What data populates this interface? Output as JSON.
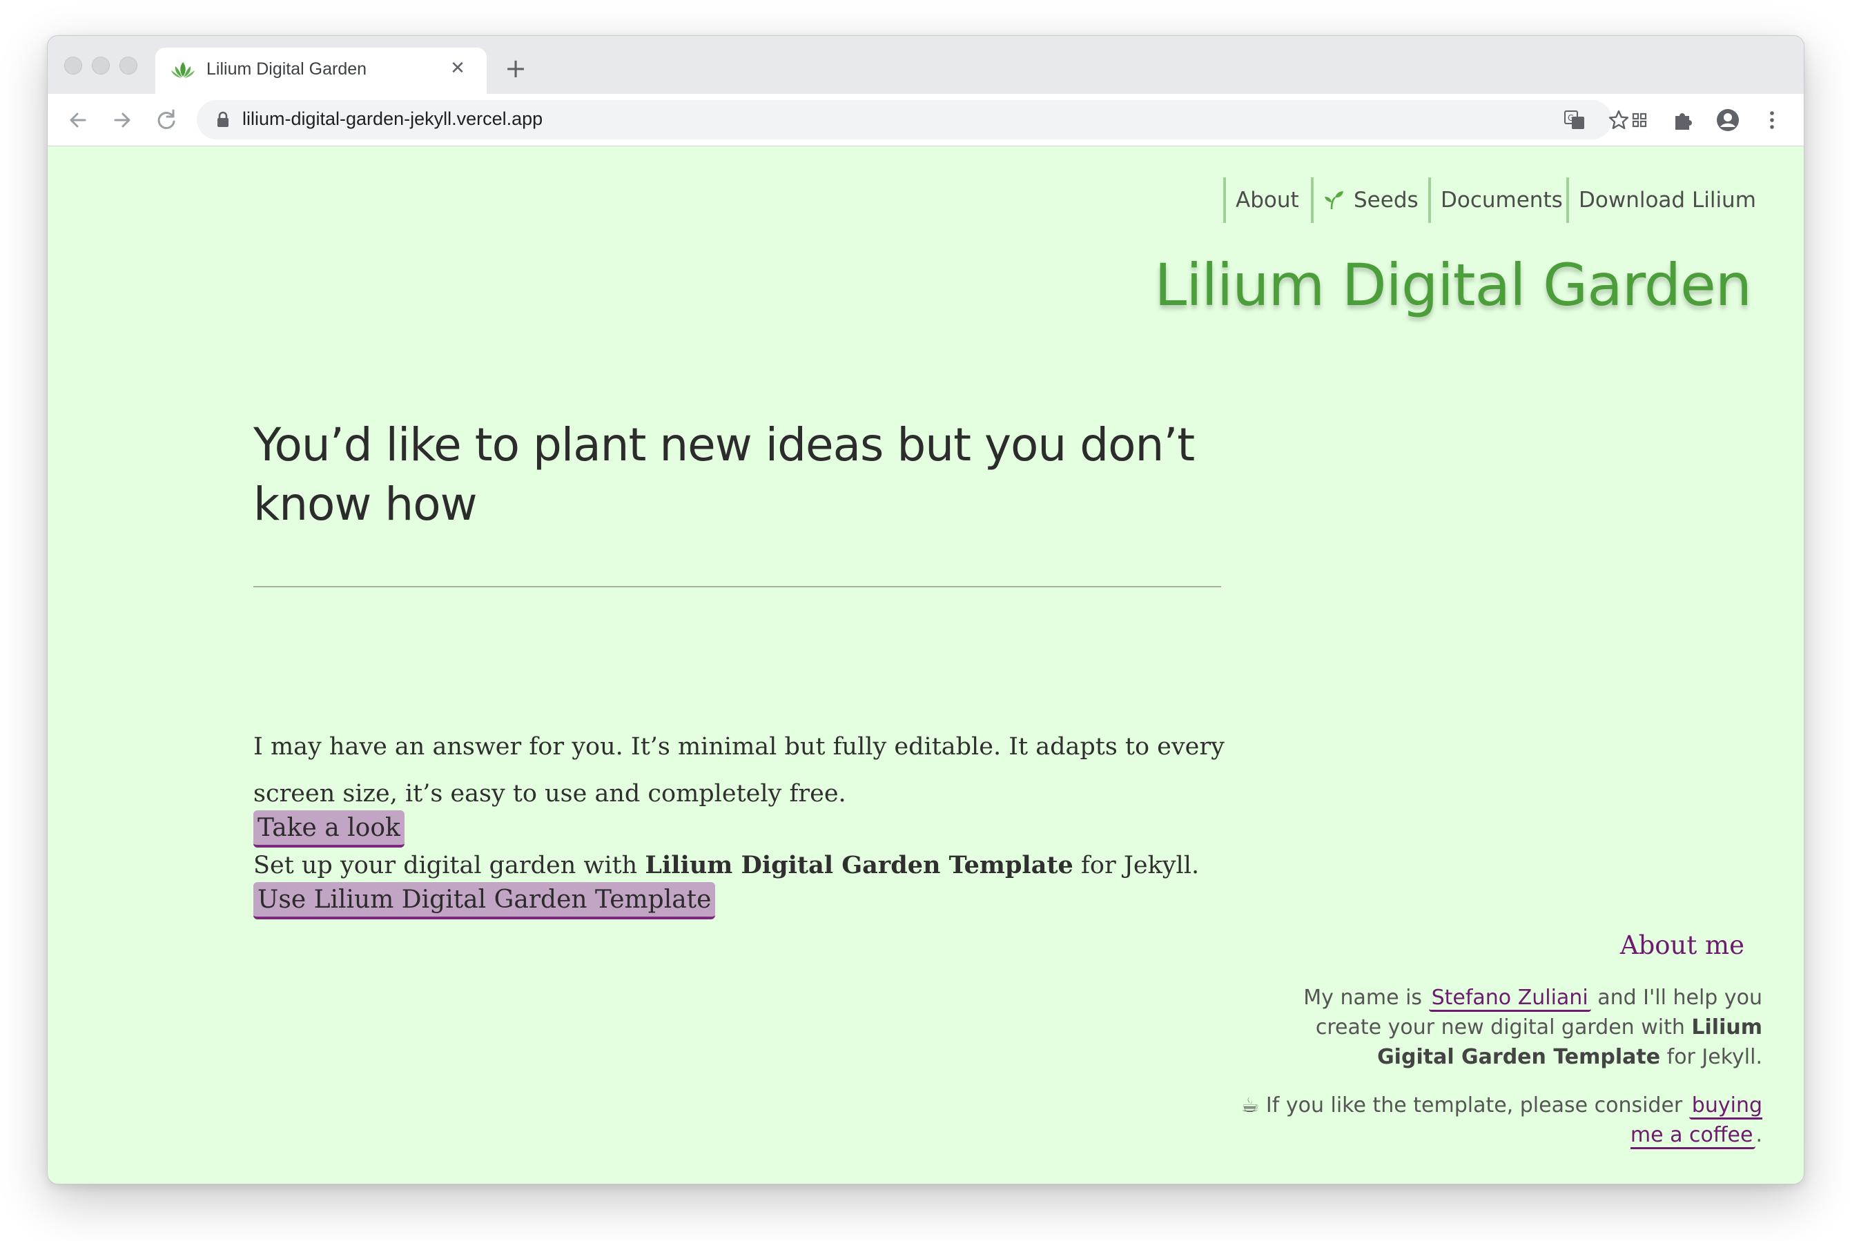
{
  "browser": {
    "tab_title": "Lilium Digital Garden",
    "tab_close": "✕",
    "new_tab": "+",
    "url": "lilium-digital-garden-jekyll.vercel.app"
  },
  "nav": {
    "items": [
      {
        "label": "About"
      },
      {
        "label": "Seeds",
        "icon": "sprout-icon"
      },
      {
        "label": "Documents"
      },
      {
        "label": "Download Lilium"
      }
    ]
  },
  "site_title": "Lilium Digital Garden",
  "hero": {
    "title": "You’d like to plant new ideas but you don’t know how",
    "para1": "I may have an answer for you. It’s minimal but fully editable. It adapts to every screen size, it’s easy to use and completely free.",
    "para2_before": "Set up your digital garden with ",
    "para2_bold": "Lilium Digital Garden Template",
    "para2_after": " for Jekyll.",
    "button_take_look": "Take a look",
    "button_use_template": "Use Lilium Digital Garden Template"
  },
  "about": {
    "heading": "About me",
    "p1_before": "My name is ",
    "p1_link": "Stefano Zuliani",
    "p1_middle": " and I'll help you create your new digital garden with ",
    "p1_bold": "Lilium Gigital Garden Template",
    "p1_after": " for Jekyll.",
    "p2_emoji": "☕",
    "p2_before": " If you like the template, please consider ",
    "p2_link": "buying me a coffee",
    "p2_after": "."
  },
  "colors": {
    "page_background": "#e4ffdf",
    "title_green": "#4b9e3a",
    "nav_divider": "#9ed294",
    "link_purple": "#6d1a70",
    "button_bg": "#c2a5c4"
  }
}
